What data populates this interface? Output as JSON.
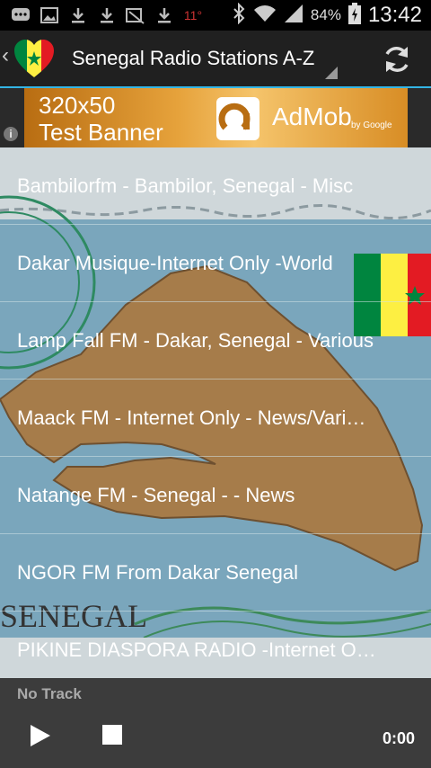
{
  "status_bar": {
    "icons": [
      "chat-icon",
      "image-icon",
      "download-icon",
      "download-icon",
      "no-image-icon",
      "download-icon",
      "temperature-icon",
      "bluetooth-icon",
      "wifi-icon",
      "signal-icon",
      "battery-icon"
    ],
    "temperature": "11°",
    "battery_percent": "84%",
    "time": "13:42"
  },
  "action_bar": {
    "title": "Senegal Radio Stations A-Z",
    "refresh_icon": "refresh-icon"
  },
  "ad": {
    "line1": "320x50",
    "line2": "Test Banner",
    "brand": "AdMob",
    "brand_suffix": "by Google",
    "info_icon": "i"
  },
  "stations": [
    "Bambilorfm - Bambilor, Senegal - Misc",
    "Dakar Musique-Internet Only -World",
    "Lamp Fall FM - Dakar, Senegal - Various",
    "Maack FM - Internet Only - News/Vari…",
    "Natange FM - Senegal - - News",
    "NGOR FM From Dakar Senegal",
    "PIKINE DIASPORA RADIO -Internet O…"
  ],
  "background": {
    "stamp_text": "SENEGAL"
  },
  "player": {
    "track": "No Track",
    "time": "0:00"
  },
  "colors": {
    "accent": "#33b5e5",
    "flag_green": "#00853f",
    "flag_yellow": "#fdef42",
    "flag_red": "#e31b23",
    "map_brown": "#a67c4a",
    "sea_blue": "#7aa6bc"
  }
}
